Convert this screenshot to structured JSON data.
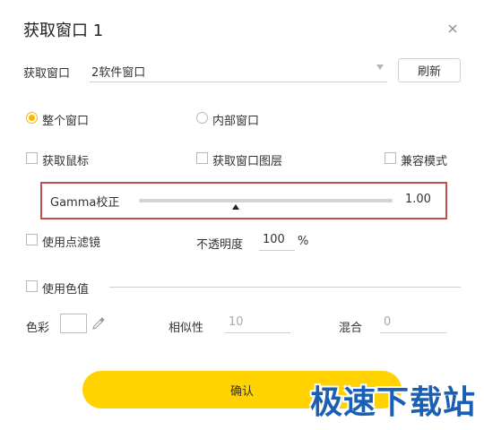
{
  "dialog": {
    "title": "获取窗口 1"
  },
  "capture": {
    "label": "获取窗口",
    "value": "2软件窗口",
    "refresh_label": "刷新"
  },
  "radios": [
    {
      "label": "整个窗口",
      "selected": true
    },
    {
      "label": "内部窗口",
      "selected": false
    }
  ],
  "checks": {
    "mouse": "获取鼠标",
    "layers": "获取窗口图层",
    "compat": "兼容模式",
    "filter": "使用点滤镜",
    "color_value": "使用色值"
  },
  "gamma": {
    "label": "Gamma校正",
    "value": "1.00",
    "level": 0.38
  },
  "opacity": {
    "label": "不透明度",
    "value": "100",
    "unit": "%"
  },
  "color": {
    "label": "色彩",
    "similarity_label": "相似性",
    "similarity_value": "10",
    "blend_label": "混合",
    "blend_value": "0"
  },
  "confirm_label": "确认",
  "watermark": "极速下载站",
  "colors": {
    "accent": "#ffd200",
    "radio_on": "#f5b800",
    "highlight_box": "#c0504d",
    "watermark": "#1b5fb5"
  }
}
